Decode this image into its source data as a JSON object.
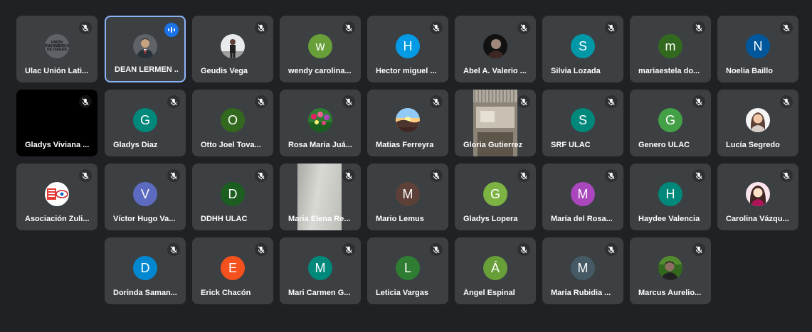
{
  "participants": [
    {
      "name": "Ulac Unión Lati...",
      "type": "logo",
      "logo_text": "UNIÓN LATINOAMERICANA DE CIEGOS",
      "muted": true
    },
    {
      "name": "DEAN LERMEN ...",
      "type": "photo",
      "photo": "man-suit",
      "muted": false,
      "speaking": true
    },
    {
      "name": "Geudis Vega",
      "type": "photo",
      "photo": "person-outdoor",
      "muted": true
    },
    {
      "name": "wendy carolina...",
      "type": "letter",
      "initial": "w",
      "color": "#689f38",
      "muted": true
    },
    {
      "name": "Hector miguel ...",
      "type": "letter",
      "initial": "H",
      "color": "#039be5",
      "muted": true
    },
    {
      "name": "Abel A. Valerio ...",
      "type": "photo",
      "photo": "man-dark",
      "muted": true
    },
    {
      "name": "Silvia Lozada",
      "type": "letter",
      "initial": "S",
      "color": "#0097a7",
      "muted": true
    },
    {
      "name": "mariaestela do...",
      "type": "letter",
      "initial": "m",
      "color": "#33691e",
      "muted": true
    },
    {
      "name": "Noelia Baillo",
      "type": "letter",
      "initial": "N",
      "color": "#01579b",
      "muted": true
    },
    {
      "name": "Gladys Viviana ...",
      "type": "video-black",
      "muted": true
    },
    {
      "name": "Gladys Diaz",
      "type": "letter",
      "initial": "G",
      "color": "#00897b",
      "muted": true
    },
    {
      "name": "Otto Joel Tova...",
      "type": "letter",
      "initial": "O",
      "color": "#33691e",
      "muted": true
    },
    {
      "name": "Rosa Maria Juá...",
      "type": "photo",
      "photo": "flowers",
      "muted": true
    },
    {
      "name": "Matias Ferreyra",
      "type": "photo",
      "photo": "sunset",
      "muted": true
    },
    {
      "name": "Gloria Gutierrez",
      "type": "video-room",
      "muted": true
    },
    {
      "name": "SRF ULAC",
      "type": "letter",
      "initial": "S",
      "color": "#00897b",
      "muted": true
    },
    {
      "name": "Genero ULAC",
      "type": "letter",
      "initial": "G",
      "color": "#43a047",
      "muted": true
    },
    {
      "name": "Lucía Segredo",
      "type": "photo",
      "photo": "woman-light",
      "muted": true
    },
    {
      "name": "Asociación Zuli...",
      "type": "photo",
      "photo": "assoc-logo",
      "muted": true
    },
    {
      "name": "Víctor Hugo Va...",
      "type": "letter",
      "initial": "V",
      "color": "#5c6bc0",
      "muted": true
    },
    {
      "name": "DDHH ULAC",
      "type": "letter",
      "initial": "D",
      "color": "#1b5e20",
      "muted": true
    },
    {
      "name": "Maria Elena Re...",
      "type": "video-grey",
      "muted": true
    },
    {
      "name": "Mario Lemus",
      "type": "letter",
      "initial": "M",
      "color": "#5d4037",
      "muted": true
    },
    {
      "name": "Gladys Lopera",
      "type": "letter",
      "initial": "G",
      "color": "#7cb342",
      "muted": true
    },
    {
      "name": "María del Rosa...",
      "type": "letter",
      "initial": "M",
      "color": "#ab47bc",
      "muted": true
    },
    {
      "name": "Haydee Valencia",
      "type": "letter",
      "initial": "H",
      "color": "#00897b",
      "muted": true
    },
    {
      "name": "Carolina Vázqu...",
      "type": "photo",
      "photo": "woman-dark",
      "muted": true
    },
    {
      "name": "Dorinda Saman...",
      "type": "letter",
      "initial": "D",
      "color": "#0288d1",
      "muted": true
    },
    {
      "name": "Erick Chacón",
      "type": "letter",
      "initial": "E",
      "color": "#f4511e",
      "muted": true
    },
    {
      "name": "Mari Carmen G...",
      "type": "letter",
      "initial": "M",
      "color": "#00897b",
      "muted": true
    },
    {
      "name": "Leticia Vargas",
      "type": "letter",
      "initial": "L",
      "color": "#2e7d32",
      "muted": true
    },
    {
      "name": "Ángel Espinal",
      "type": "letter",
      "initial": "Á",
      "color": "#689f38",
      "muted": true
    },
    {
      "name": "Maria Rubidia ...",
      "type": "letter",
      "initial": "M",
      "color": "#455a64",
      "muted": true
    },
    {
      "name": "Marcus Aurelio...",
      "type": "photo",
      "photo": "man-green",
      "muted": true
    }
  ]
}
